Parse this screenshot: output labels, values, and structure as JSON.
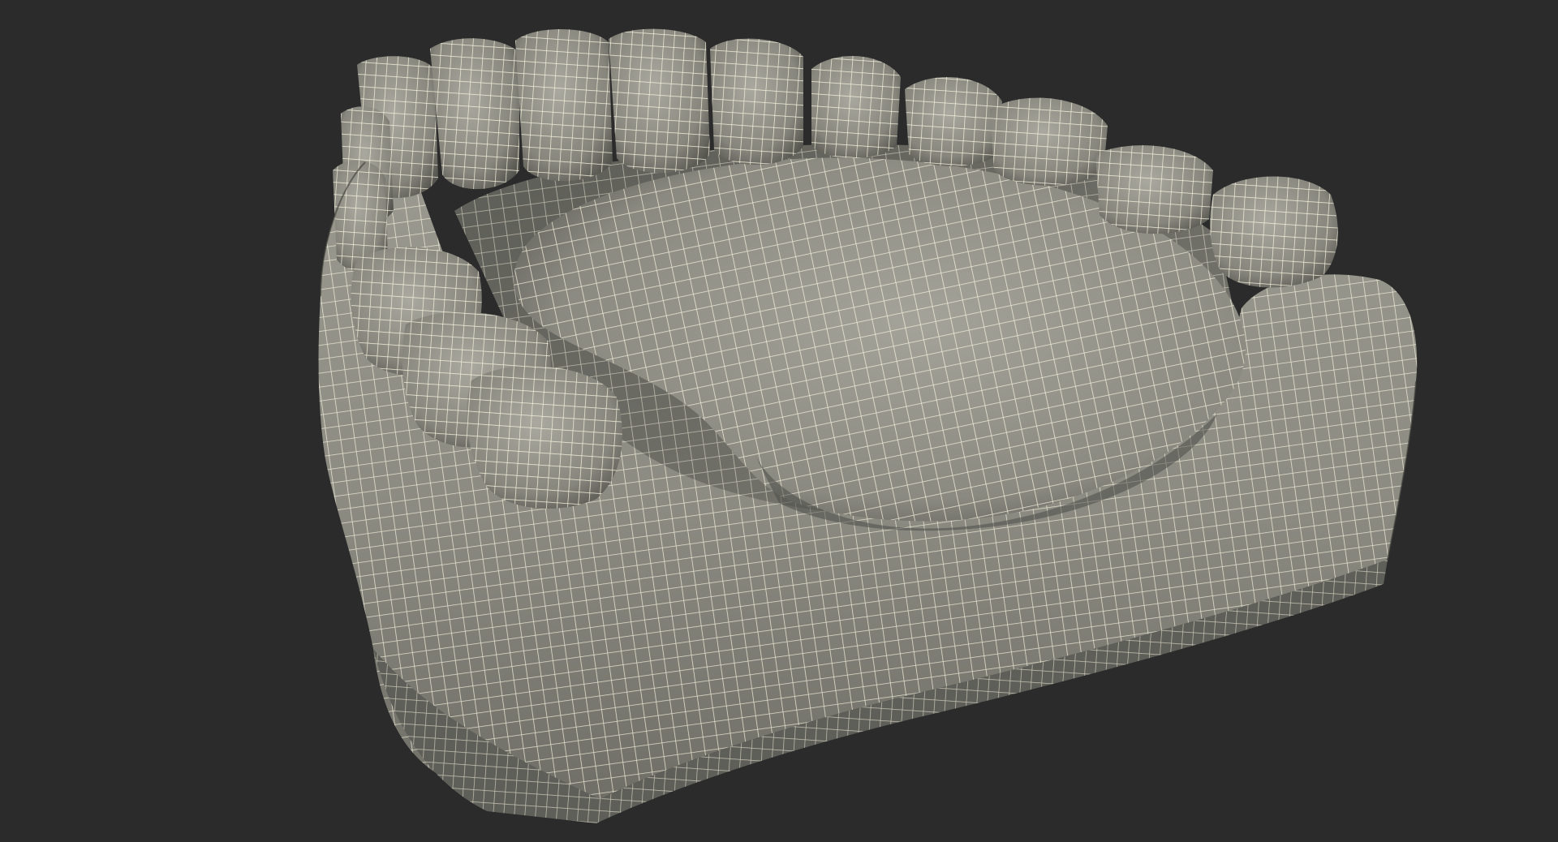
{
  "scene": {
    "background_color": "#2b2b2b",
    "surface_color": "#8f8f86",
    "surface_shadow_color": "#4f4f4a",
    "surface_highlight_color": "#a9a99f",
    "wire_color": "#f4f0dc",
    "subject": "wireframe-dental-model"
  }
}
